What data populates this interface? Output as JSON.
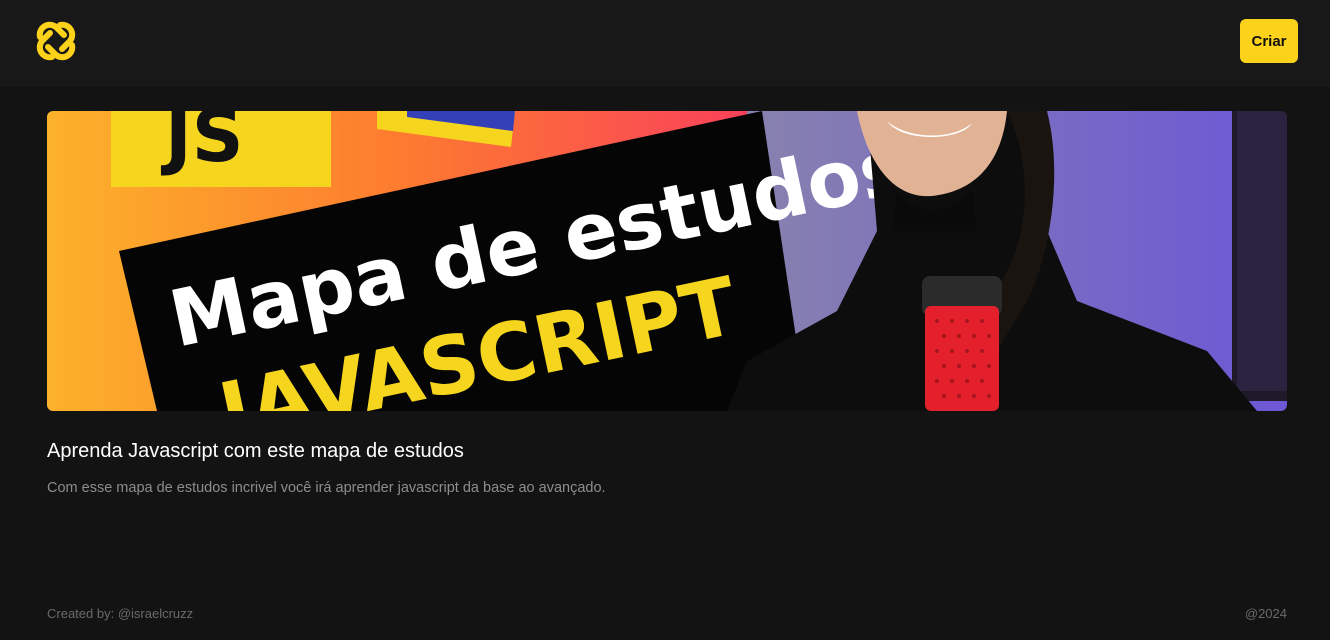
{
  "header": {
    "logo_icon": "knot-logo-icon",
    "create_label": "Criar",
    "accent": "#fdd21b"
  },
  "post": {
    "thumbnail": {
      "badge_text": "JS",
      "headline": "Mapa de estudos",
      "subheadline": "JAVASCRIPT",
      "microphone_color": "#e3202b"
    },
    "title": "Aprenda Javascript com este mapa de estudos",
    "description": "Com esse mapa de estudos incrivel você irá aprender javascript da base ao avançado."
  },
  "footer": {
    "credit": "Created by: @israelcruzz",
    "year": "@2024"
  }
}
